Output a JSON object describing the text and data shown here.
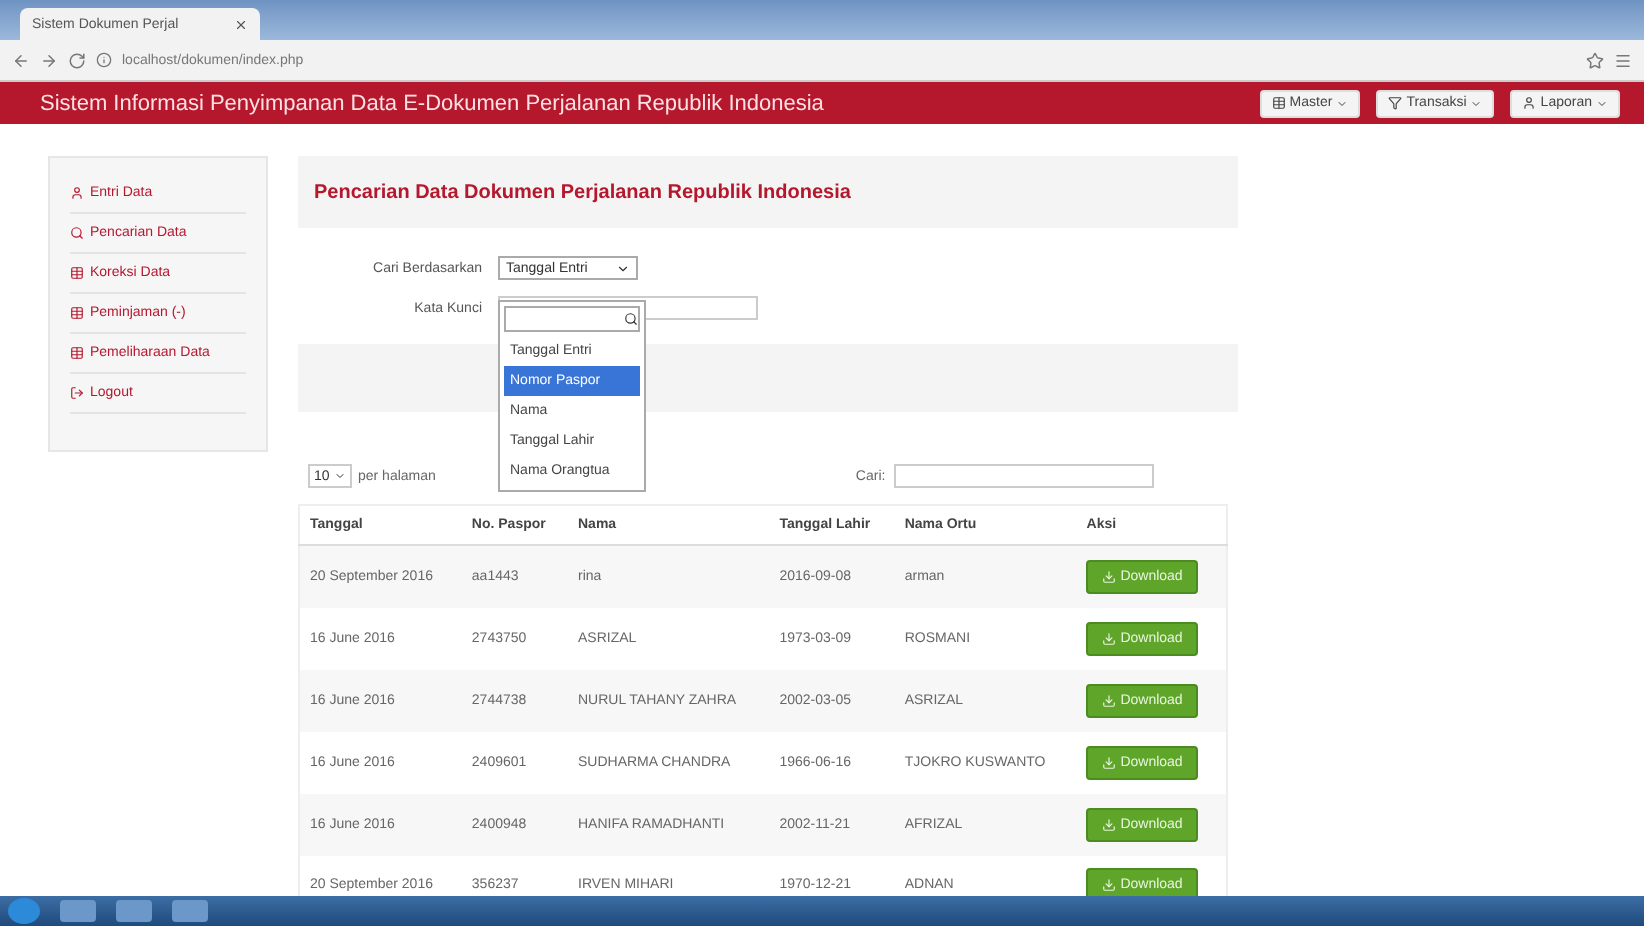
{
  "browser": {
    "tab_title": "Sistem Dokumen Perjal",
    "url": "localhost/dokumen/index.php"
  },
  "navbar": {
    "title": "Sistem Informasi Penyimpanan Data E-Dokumen Perjalanan Republik Indonesia",
    "menus": [
      {
        "label": "Master",
        "kind": "table"
      },
      {
        "label": "Transaksi",
        "kind": "filter"
      },
      {
        "label": "Laporan",
        "kind": "user"
      }
    ]
  },
  "sidebar": {
    "items": [
      {
        "label": "Entri Data",
        "kind": "user"
      },
      {
        "label": "Pencarian Data",
        "kind": "search"
      },
      {
        "label": "Koreksi Data",
        "kind": "table"
      },
      {
        "label": "Peminjaman (-)",
        "kind": "table"
      },
      {
        "label": "Pemeliharaan Data",
        "kind": "table"
      },
      {
        "label": "Logout",
        "kind": "logout"
      }
    ]
  },
  "search_panel": {
    "title": "Pencarian Data Dokumen Perjalanan Republik Indonesia",
    "search_by_label": "Cari Berdasarkan",
    "search_by_value": "Tanggal Entri",
    "keyword_label": "Kata Kunci",
    "dropdown": {
      "options": [
        {
          "label": "Tanggal Entri",
          "selected": false
        },
        {
          "label": "Nomor Paspor",
          "selected": true
        },
        {
          "label": "Nama",
          "selected": false
        },
        {
          "label": "Tanggal Lahir",
          "selected": false
        },
        {
          "label": "Nama Orangtua",
          "selected": false
        }
      ]
    }
  },
  "table_controls": {
    "page_size": "10",
    "page_size_label": "per halaman",
    "search_label": "Cari:"
  },
  "table": {
    "columns": [
      "Tanggal",
      "No. Paspor",
      "Nama",
      "Tanggal Lahir",
      "Nama Ortu",
      "Aksi"
    ],
    "rows": [
      {
        "cells": [
          "20 September 2016",
          "aa1443",
          "rina",
          "2016-09-08",
          "arman"
        ],
        "action": "Download"
      },
      {
        "cells": [
          "16 June 2016",
          "2743750",
          "ASRIZAL",
          "1973-03-09",
          "ROSMANI"
        ],
        "action": "Download"
      },
      {
        "cells": [
          "16 June 2016",
          "2744738",
          "NURUL TAHANY ZAHRA",
          "2002-03-05",
          "ASRIZAL"
        ],
        "action": "Download"
      },
      {
        "cells": [
          "16 June 2016",
          "2409601",
          "SUDHARMA CHANDRA",
          "1966-06-16",
          "TJOKRO KUSWANTO"
        ],
        "action": "Download"
      },
      {
        "cells": [
          "16 June 2016",
          "2400948",
          "HANIFA RAMADHANTI",
          "2002-11-21",
          "AFRIZAL"
        ],
        "action": "Download"
      },
      {
        "cells": [
          "20 September 2016",
          "356237",
          "IRVEN MIHARI",
          "1970-12-21",
          "ADNAN"
        ],
        "action": "Download"
      }
    ]
  }
}
